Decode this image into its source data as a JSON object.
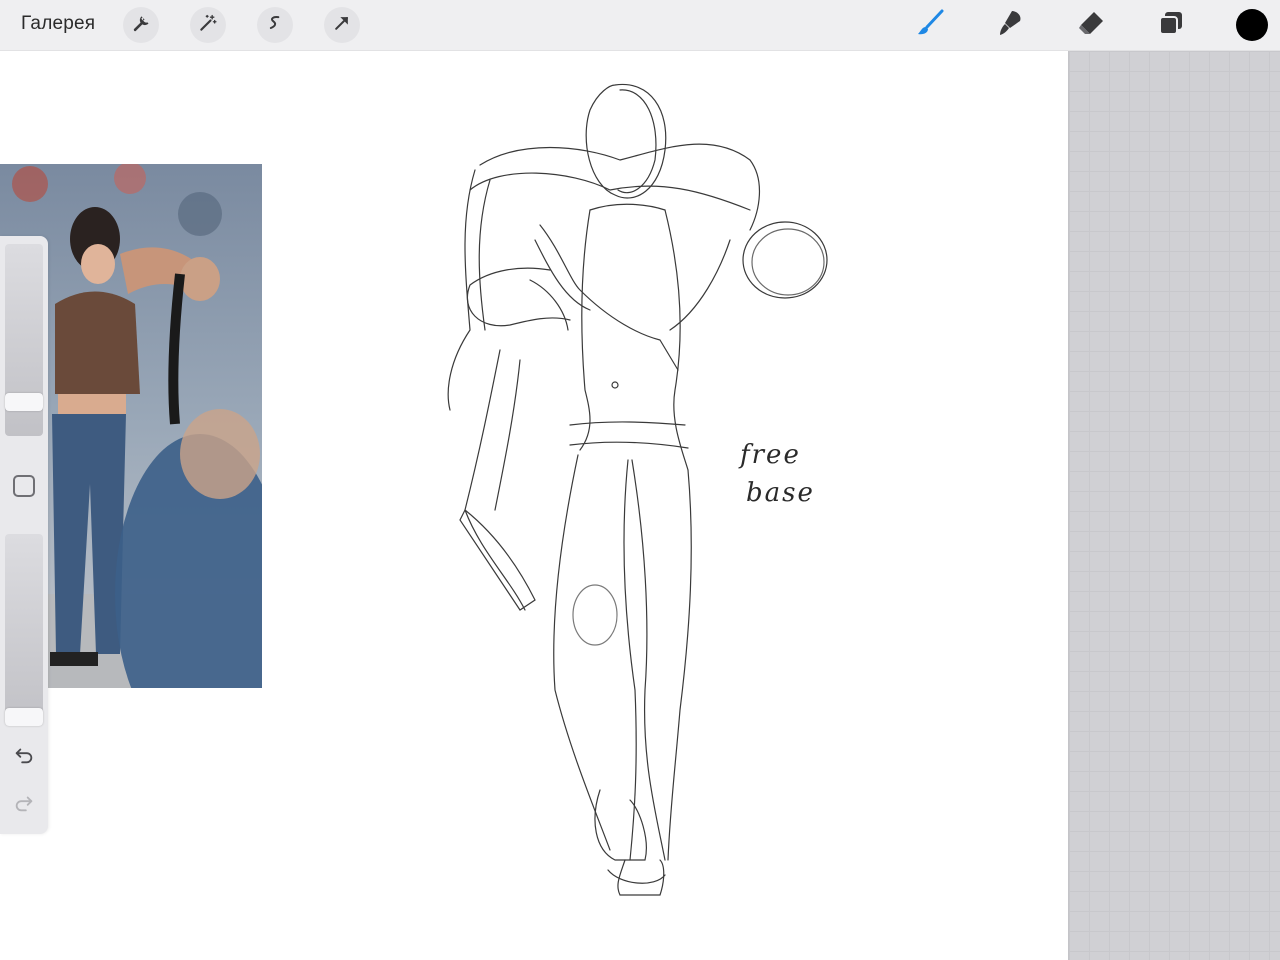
{
  "toolbar": {
    "gallery_label": "Галерея",
    "left_tools": [
      {
        "name": "wrench-icon",
        "tool": "Actions"
      },
      {
        "name": "magic-wand-icon",
        "tool": "Adjustments"
      },
      {
        "name": "selection-icon",
        "tool": "Selection"
      },
      {
        "name": "transform-arrow-icon",
        "tool": "Transform"
      }
    ],
    "right_tools": [
      {
        "name": "brush-icon",
        "active": true,
        "color": "#1e88e5"
      },
      {
        "name": "smudge-icon",
        "active": false
      },
      {
        "name": "eraser-icon",
        "active": false
      },
      {
        "name": "layers-icon",
        "active": false
      }
    ],
    "current_color": "#000000"
  },
  "sidebar": {
    "brush_size_slider": {
      "level": 0.82
    },
    "opacity_slider": {
      "level": 0.05
    },
    "modifier_icon": "square-modifier-icon",
    "undo_icon": "undo-icon",
    "redo_icon": "redo-icon"
  },
  "canvas": {
    "annotation_line1": "free",
    "annotation_line2": "base"
  },
  "colors": {
    "toolbar_bg": "#efeff1",
    "canvas_bg": "#ffffff",
    "side_panel_bg": "#d0d0d4",
    "accent": "#1e88e5"
  }
}
